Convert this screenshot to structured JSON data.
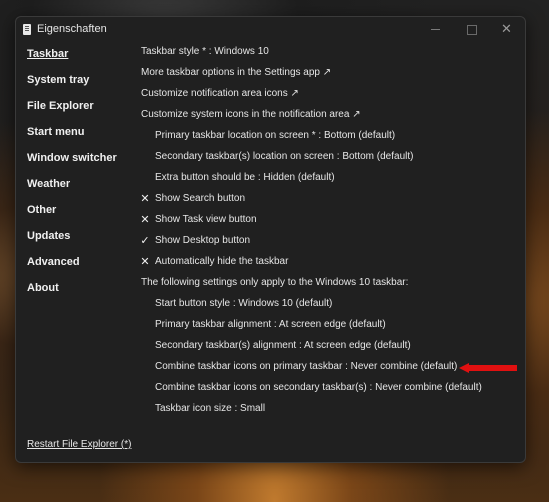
{
  "window": {
    "title": "Eigenschaften",
    "close_glyph": "✕"
  },
  "sidebar": {
    "items": [
      {
        "label": "Taskbar",
        "active": true
      },
      {
        "label": "System tray",
        "active": false
      },
      {
        "label": "File Explorer",
        "active": false
      },
      {
        "label": "Start menu",
        "active": false
      },
      {
        "label": "Window switcher",
        "active": false
      },
      {
        "label": "Weather",
        "active": false
      },
      {
        "label": "Other",
        "active": false
      },
      {
        "label": "Updates",
        "active": false
      },
      {
        "label": "Advanced",
        "active": false
      },
      {
        "label": "About",
        "active": false
      }
    ],
    "restart_label": "Restart File Explorer (*)"
  },
  "settings": {
    "taskbar_style": "Taskbar style * : Windows 10",
    "more_options": "More taskbar options in the Settings app ↗",
    "customize_notification": "Customize notification area icons ↗",
    "customize_system_icons": "Customize system icons in the notification area ↗",
    "primary_location": "Primary taskbar location on screen * : Bottom (default)",
    "secondary_location": "Secondary taskbar(s) location on screen : Bottom (default)",
    "extra_button": "Extra button should be : Hidden (default)",
    "show_search": {
      "mark": "✕",
      "label": "Show Search button"
    },
    "show_task_view": {
      "mark": "✕",
      "label": "Show Task view button"
    },
    "show_desktop": {
      "mark": "✓",
      "label": "Show Desktop button"
    },
    "auto_hide": {
      "mark": "✕",
      "label": "Automatically hide the taskbar"
    },
    "win10_note": "The following settings only apply to the Windows 10 taskbar:",
    "start_button_style": "Start button style : Windows 10 (default)",
    "primary_alignment": "Primary taskbar alignment : At screen edge (default)",
    "secondary_alignment": "Secondary taskbar(s) alignment : At screen edge (default)",
    "combine_primary": "Combine taskbar icons on primary taskbar : Never combine (default)",
    "combine_secondary": "Combine taskbar icons on secondary taskbar(s) : Never combine (default)",
    "icon_size": "Taskbar icon size : Small"
  },
  "colors": {
    "window_bg": "#202020",
    "annotation_arrow": "#e01010"
  }
}
